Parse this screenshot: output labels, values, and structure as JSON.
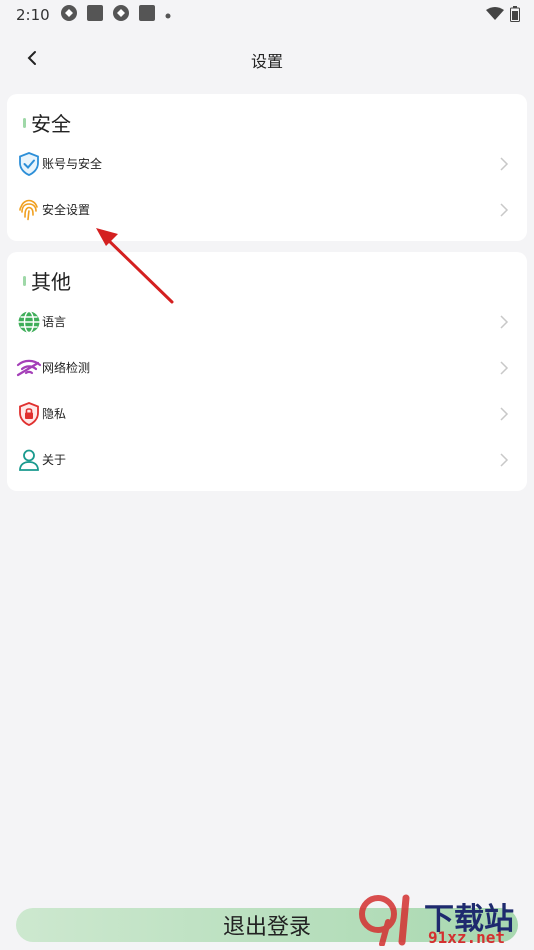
{
  "status_bar": {
    "time": "2:10"
  },
  "header": {
    "title": "设置"
  },
  "sections": [
    {
      "title": "安全",
      "items": [
        {
          "label": "账号与安全",
          "icon": "shield-check-icon"
        },
        {
          "label": "安全设置",
          "icon": "fingerprint-icon"
        }
      ]
    },
    {
      "title": "其他",
      "items": [
        {
          "label": "语言",
          "icon": "globe-icon"
        },
        {
          "label": "网络检测",
          "icon": "wifi-icon"
        },
        {
          "label": "隐私",
          "icon": "privacy-lock-icon"
        },
        {
          "label": "关于",
          "icon": "person-icon"
        }
      ]
    }
  ],
  "logout": {
    "label": "退出登录"
  },
  "watermark": {
    "main": "下载站",
    "sub": "91xz.net"
  },
  "colors": {
    "background": "#f4f4f6",
    "accent_green": "#9fd8a8",
    "annotation_arrow": "#d42020"
  }
}
